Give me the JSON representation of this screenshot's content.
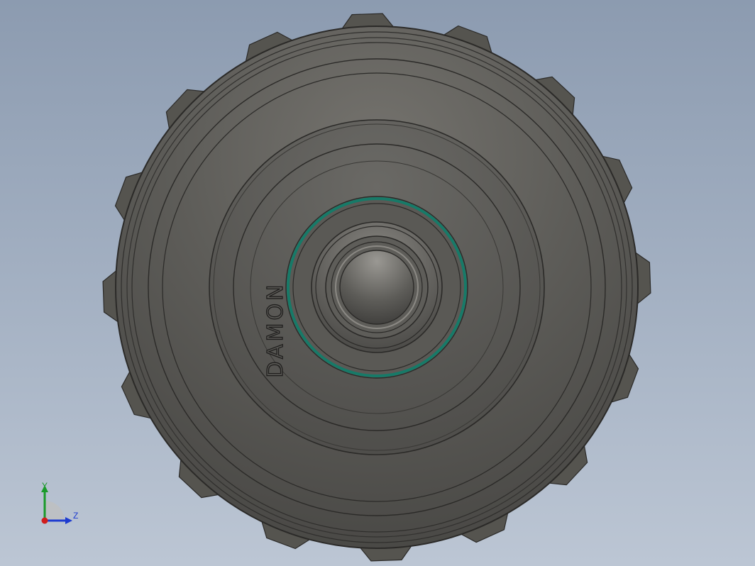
{
  "part": {
    "engraved_text": "DAMON",
    "colors": {
      "background_top": "#8c9bb0",
      "background_bottom": "#bcc6d4",
      "body_fill": "#5e5d5a",
      "body_edge": "#2b2a28",
      "teeth_fill": "#55544f",
      "seal_ring": "#177a68"
    },
    "tooth_count": 16
  },
  "triad": {
    "y_label": "Y",
    "z_label": "Z",
    "colors": {
      "y_axis": "#1a9a2a",
      "z_axis": "#1d3bd0",
      "x_axis": "#d01d1d"
    }
  }
}
